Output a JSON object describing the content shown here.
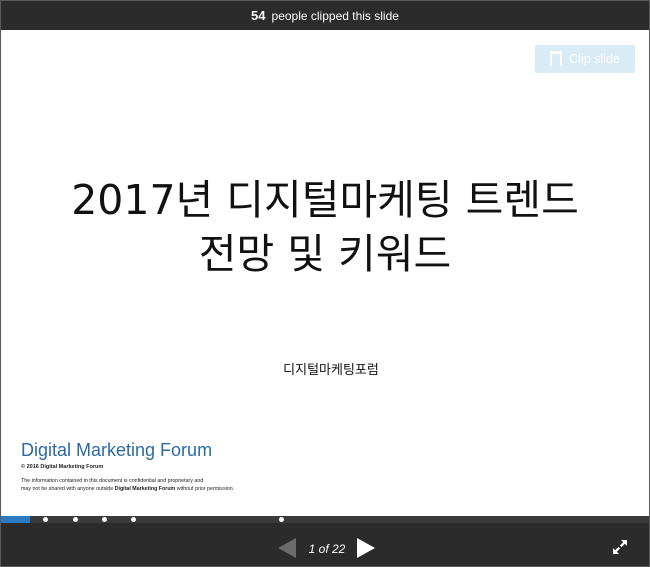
{
  "header": {
    "clip_count": "54",
    "clip_text": "people clipped this slide"
  },
  "clip_button": {
    "label": "Clip slide",
    "icon": "clipboard-icon"
  },
  "slide": {
    "title_line1": "2017년 디지털마케팅 트렌드",
    "title_line2": "전망 및 키워드",
    "subtitle": "디지털마케팅포럼",
    "brand": "Digital Marketing Forum",
    "copyright": "© 2016 Digital Marketing Forum",
    "disclaimer_line1": "The information contained in this document is confidential and proprietary and",
    "disclaimer_line2_start": "may not be shared with anyone outside ",
    "disclaimer_line2_bold": "Digital Marketing Forum",
    "disclaimer_line2_end": " without prior permission."
  },
  "progress": {
    "current": 1,
    "total": 22,
    "fraction": 0.045
  },
  "navigation": {
    "page_indicator": "1 of 22",
    "prev_icon": "prev-arrow-icon",
    "next_icon": "next-arrow-icon",
    "fullscreen_icon": "fullscreen-icon"
  },
  "colors": {
    "bar": "#2b2b2b",
    "accent": "#2a7bbf",
    "brand": "#2e6aa3",
    "clip_button": "#d9ebf5"
  }
}
